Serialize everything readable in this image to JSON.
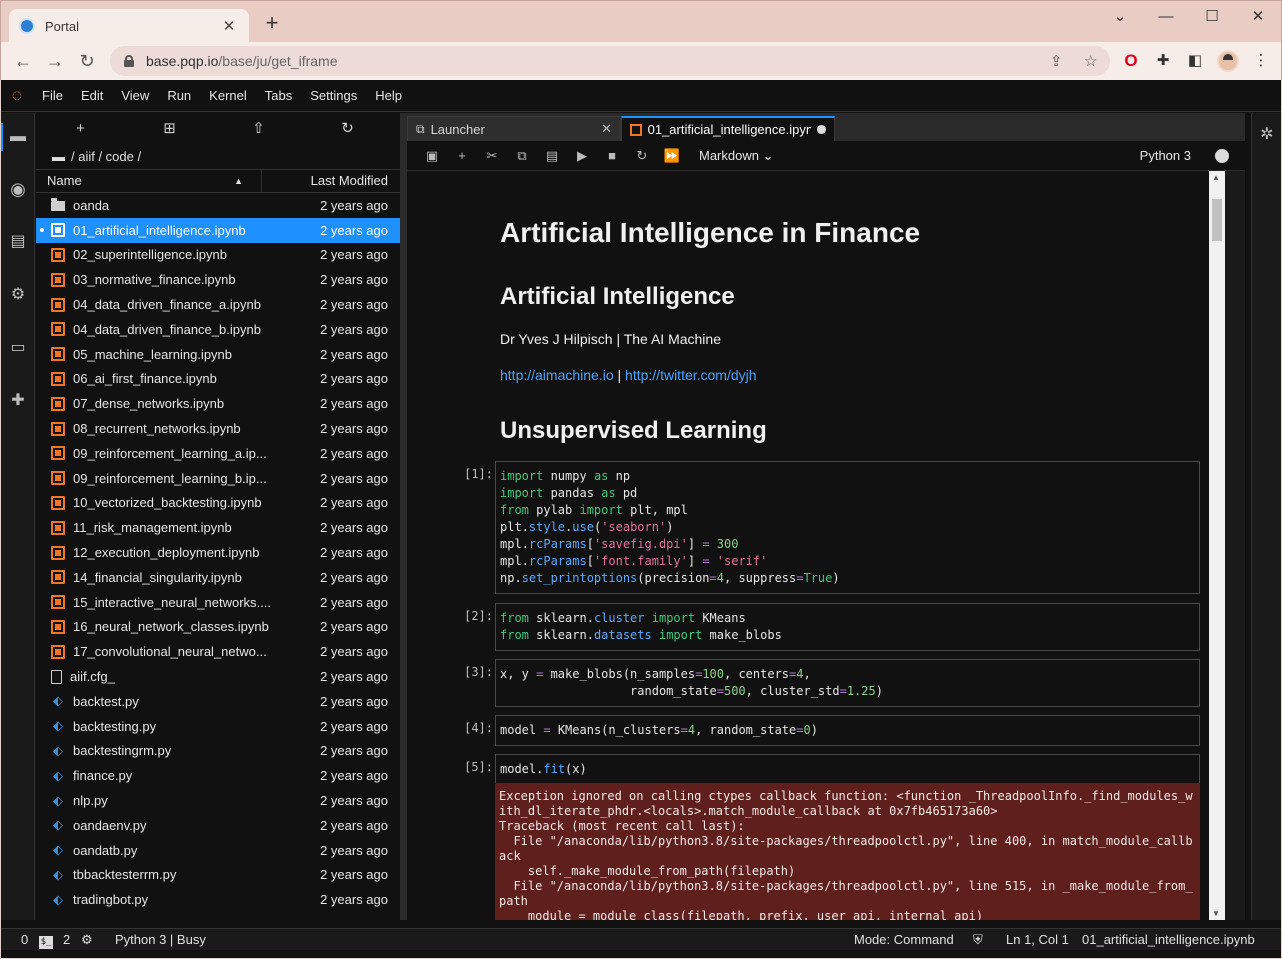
{
  "browser": {
    "tab_title": "Portal",
    "url_host": "base.pqp.io",
    "url_path": "/base/ju/get_iframe"
  },
  "menu": [
    "File",
    "Edit",
    "View",
    "Run",
    "Kernel",
    "Tabs",
    "Settings",
    "Help"
  ],
  "filebrowser": {
    "breadcrumb": "/ aiif / code /",
    "col_name": "Name",
    "col_modified": "Last Modified",
    "files": [
      {
        "name": "oanda",
        "type": "folder",
        "modified": "2 years ago"
      },
      {
        "name": "01_artificial_intelligence.ipynb",
        "type": "notebook",
        "modified": "2 years ago",
        "selected": true
      },
      {
        "name": "02_superintelligence.ipynb",
        "type": "notebook",
        "modified": "2 years ago"
      },
      {
        "name": "03_normative_finance.ipynb",
        "type": "notebook",
        "modified": "2 years ago"
      },
      {
        "name": "04_data_driven_finance_a.ipynb",
        "type": "notebook",
        "modified": "2 years ago"
      },
      {
        "name": "04_data_driven_finance_b.ipynb",
        "type": "notebook",
        "modified": "2 years ago"
      },
      {
        "name": "05_machine_learning.ipynb",
        "type": "notebook",
        "modified": "2 years ago"
      },
      {
        "name": "06_ai_first_finance.ipynb",
        "type": "notebook",
        "modified": "2 years ago"
      },
      {
        "name": "07_dense_networks.ipynb",
        "type": "notebook",
        "modified": "2 years ago"
      },
      {
        "name": "08_recurrent_networks.ipynb",
        "type": "notebook",
        "modified": "2 years ago"
      },
      {
        "name": "09_reinforcement_learning_a.ip...",
        "type": "notebook",
        "modified": "2 years ago"
      },
      {
        "name": "09_reinforcement_learning_b.ip...",
        "type": "notebook",
        "modified": "2 years ago"
      },
      {
        "name": "10_vectorized_backtesting.ipynb",
        "type": "notebook",
        "modified": "2 years ago"
      },
      {
        "name": "11_risk_management.ipynb",
        "type": "notebook",
        "modified": "2 years ago"
      },
      {
        "name": "12_execution_deployment.ipynb",
        "type": "notebook",
        "modified": "2 years ago"
      },
      {
        "name": "14_financial_singularity.ipynb",
        "type": "notebook",
        "modified": "2 years ago"
      },
      {
        "name": "15_interactive_neural_networks....",
        "type": "notebook",
        "modified": "2 years ago"
      },
      {
        "name": "16_neural_network_classes.ipynb",
        "type": "notebook",
        "modified": "2 years ago"
      },
      {
        "name": "17_convolutional_neural_netwo...",
        "type": "notebook",
        "modified": "2 years ago"
      },
      {
        "name": "aiif.cfg_",
        "type": "file",
        "modified": "2 years ago"
      },
      {
        "name": "backtest.py",
        "type": "python",
        "modified": "2 years ago"
      },
      {
        "name": "backtesting.py",
        "type": "python",
        "modified": "2 years ago"
      },
      {
        "name": "backtestingrm.py",
        "type": "python",
        "modified": "2 years ago"
      },
      {
        "name": "finance.py",
        "type": "python",
        "modified": "2 years ago"
      },
      {
        "name": "nlp.py",
        "type": "python",
        "modified": "2 years ago"
      },
      {
        "name": "oandaenv.py",
        "type": "python",
        "modified": "2 years ago"
      },
      {
        "name": "oandatb.py",
        "type": "python",
        "modified": "2 years ago"
      },
      {
        "name": "tbbacktesterrm.py",
        "type": "python",
        "modified": "2 years ago"
      },
      {
        "name": "tradingbot.py",
        "type": "python",
        "modified": "2 years ago"
      }
    ]
  },
  "tabs": {
    "launcher": "Launcher",
    "notebook": "01_artificial_intelligence.ipynb"
  },
  "toolbar": {
    "cell_type": "Markdown",
    "kernel": "Python 3"
  },
  "notebook": {
    "title": "Artificial Intelligence in Finance",
    "subtitle": "Artificial Intelligence",
    "author": "Dr Yves J Hilpisch | The AI Machine",
    "link1": "http://aimachine.io",
    "link_sep": " | ",
    "link2": "http://twitter.com/dyjh",
    "section": "Unsupervised Learning",
    "prompts": [
      "[1]:",
      "[2]:",
      "[3]:",
      "[4]:",
      "[5]:"
    ],
    "error_text": "Exception ignored on calling ctypes callback function: <function _ThreadpoolInfo._find_modules_with_dl_iterate_phdr.<locals>.match_module_callback at 0x7fb465173a60>\nTraceback (most recent call last):\n  File \"/anaconda/lib/python3.8/site-packages/threadpoolctl.py\", line 400, in match_module_callback\n    self._make_module_from_path(filepath)\n  File \"/anaconda/lib/python3.8/site-packages/threadpoolctl.py\", line 515, in _make_module_from_path\n    module = module_class(filepath, prefix, user_api, internal_api)"
  },
  "status": {
    "terminals": "0",
    "kernels": "2",
    "kernel_state": "Python 3 | Busy",
    "mode": "Mode: Command",
    "position": "Ln 1, Col 1",
    "file": "01_artificial_intelligence.ipynb"
  },
  "colors": {
    "accent": "#1e90ff",
    "jupyter_orange": "#f37626",
    "error_bg": "#5f1f1c"
  }
}
